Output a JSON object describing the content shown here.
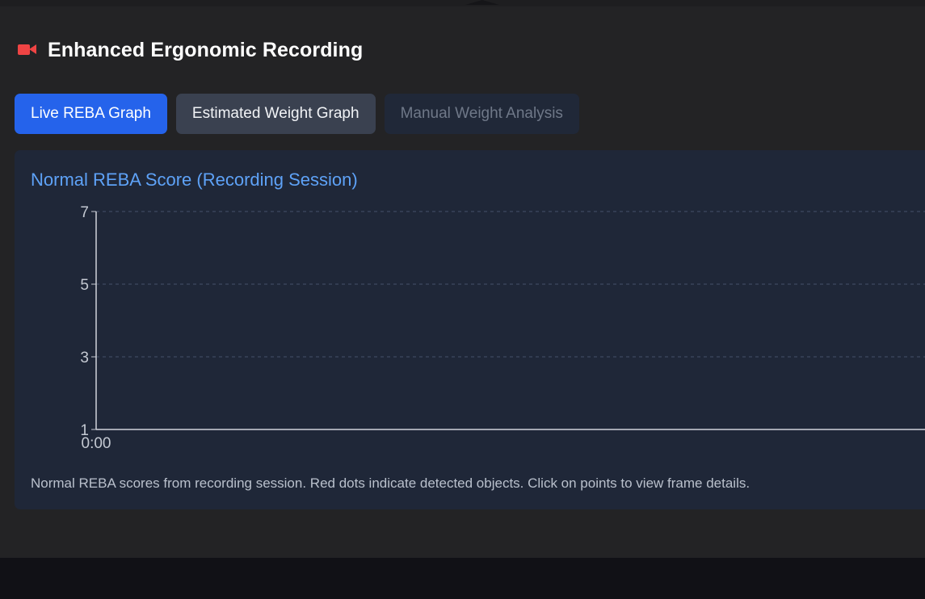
{
  "header": {
    "icon": "video-camera-icon",
    "title": "Enhanced Ergonomic Recording"
  },
  "tabs": [
    {
      "label": "Live REBA Graph",
      "state": "active"
    },
    {
      "label": "Estimated Weight Graph",
      "state": "inactive"
    },
    {
      "label": "Manual Weight Analysis",
      "state": "disabled"
    }
  ],
  "card": {
    "title": "Normal REBA Score (Recording Session)",
    "caption": "Normal REBA scores from recording session. Red dots indicate detected objects. Click on points to view frame details."
  },
  "chart_data": {
    "type": "line",
    "title": "Normal REBA Score (Recording Session)",
    "xlabel": "",
    "ylabel": "",
    "x_ticks": [
      "0:00"
    ],
    "y_ticks": [
      1,
      3,
      5,
      7
    ],
    "ylim": [
      1,
      7
    ],
    "grid": true,
    "series": []
  },
  "colors": {
    "accent": "#2563eb",
    "title_accent": "#5ea2f7",
    "camera_icon": "#ef4444",
    "card_bg": "#1f2738"
  }
}
